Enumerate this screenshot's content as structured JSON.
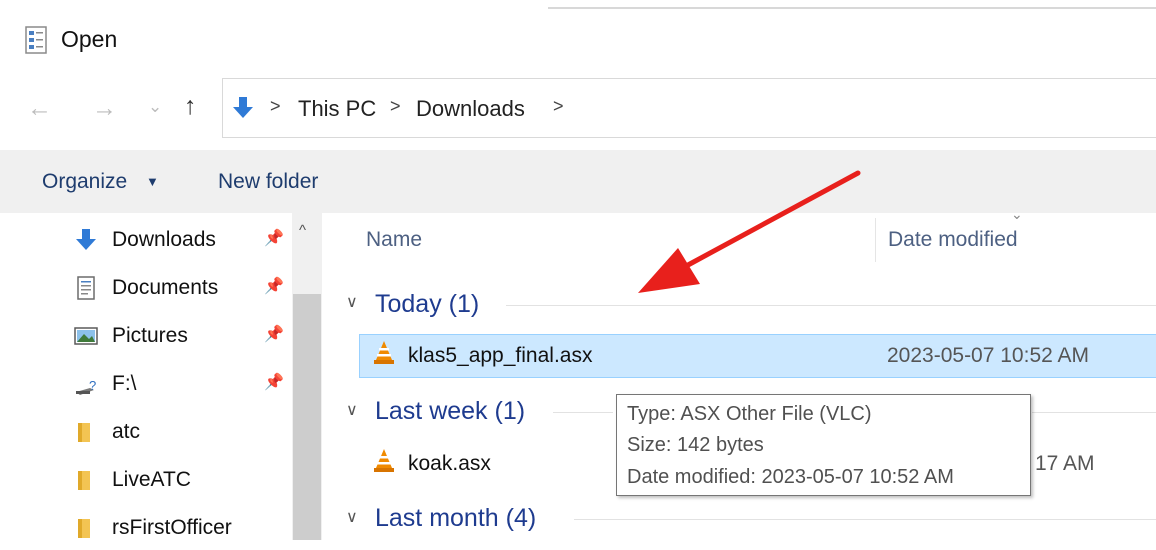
{
  "window": {
    "title": "Open",
    "title_icon": "open-dialog-icon"
  },
  "address": {
    "icon": "downloads-arrow-icon",
    "crumbs": [
      "This PC",
      "Downloads"
    ]
  },
  "nav_buttons": {
    "back": "←",
    "forward": "→",
    "recent": "⌄",
    "up": "↑"
  },
  "toolbar": {
    "organize_label": "Organize",
    "new_folder_label": "New folder"
  },
  "sidebar": {
    "items": [
      {
        "label": "Downloads",
        "icon": "downloads-arrow-icon",
        "pinned": true
      },
      {
        "label": "Documents",
        "icon": "documents-icon",
        "pinned": true
      },
      {
        "label": "Pictures",
        "icon": "pictures-icon",
        "pinned": true
      },
      {
        "label": "F:\\",
        "icon": "removable-drive-icon",
        "pinned": true
      },
      {
        "label": "atc",
        "icon": "folder-icon",
        "pinned": false
      },
      {
        "label": "LiveATC",
        "icon": "folder-icon",
        "pinned": false
      },
      {
        "label": "rsFirstOfficer",
        "icon": "folder-icon",
        "pinned": false
      }
    ]
  },
  "columns": {
    "name": "Name",
    "date_modified": "Date modified"
  },
  "groups": [
    {
      "label": "Today (1)",
      "files": [
        {
          "name": "klas5_app_final.asx",
          "date": "2023-05-07 10:52 AM",
          "selected": true
        }
      ]
    },
    {
      "label": "Last week (1)",
      "files": [
        {
          "name": "koak.asx",
          "date": "17 AM",
          "selected": false
        }
      ]
    },
    {
      "label": "Last month (4)",
      "files": []
    }
  ],
  "tooltip": {
    "type": "Type: ASX Other File (VLC)",
    "size": "Size: 142 bytes",
    "date": "Date modified: 2023-05-07 10:52 AM"
  },
  "colors": {
    "selection": "#cce8ff",
    "group_header": "#1e3b8f",
    "annotation_arrow": "#e8201c",
    "vlc_orange": "#f08a00"
  }
}
